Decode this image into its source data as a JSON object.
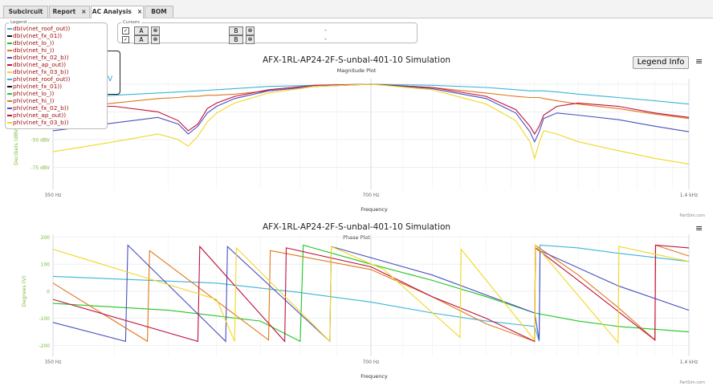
{
  "tabs": [
    {
      "label": "Subcircuit",
      "closable": false
    },
    {
      "label": "Report",
      "closable": true
    },
    {
      "label": "AC Analysis",
      "closable": true,
      "active": true
    },
    {
      "label": "BOM",
      "closable": false
    }
  ],
  "legend": {
    "title": "Legend",
    "items": [
      {
        "label": "db(v(net_roof_out))",
        "color": "#3bb4d8"
      },
      {
        "label": "db(v(net_fx_01))",
        "color": "#111111"
      },
      {
        "label": "db(v(net_lo_))",
        "color": "#22c422"
      },
      {
        "label": "db(v(net_hi_))",
        "color": "#e0771c"
      },
      {
        "label": "db(v(net_fx_02_b))",
        "color": "#4a4fc0"
      },
      {
        "label": "db(v(net_ap_out))",
        "color": "#c0103c"
      },
      {
        "label": "db(v(net_fx_03_b))",
        "color": "#f0d821"
      },
      {
        "label": "ph(v(net_roof_out))",
        "color": "#3bb4d8"
      },
      {
        "label": "ph(v(net_fx_01))",
        "color": "#111111"
      },
      {
        "label": "ph(v(net_lo_))",
        "color": "#22c422"
      },
      {
        "label": "ph(v(net_hi_))",
        "color": "#e0771c"
      },
      {
        "label": "ph(v(net_fx_02_b))",
        "color": "#4a4fc0"
      },
      {
        "label": "ph(v(net_ap_out))",
        "color": "#c0103c"
      },
      {
        "label": "ph(v(net_fx_03_b))",
        "color": "#f0d821"
      }
    ]
  },
  "cursors": {
    "title": "Cursors",
    "rows": [
      {
        "checked": true,
        "a_label": "A",
        "b_label": "B",
        "value": "-"
      },
      {
        "checked": true,
        "a_label": "A",
        "b_label": "B",
        "value": "-"
      }
    ],
    "close_glyph": "⊗"
  },
  "popup": {
    "partial_text": "V"
  },
  "legend_info_label": "Legend Info",
  "menu_glyph": "≡",
  "credit": "PartSim.com",
  "charts": {
    "magnitude": {
      "title": "AFX-1RL-AP24-2F-S-unbal-401-10 Simulation",
      "subtitle": "Magnitude Plot",
      "ylabel": "Decibels (dBV)",
      "xlabel": "Frequency",
      "yticks": [
        "-50 dBV",
        "-75 dBV"
      ],
      "xticks": [
        "350 Hz",
        "700 Hz",
        "1.4 kHz"
      ]
    },
    "phase": {
      "title": "AFX-1RL-AP24-2F-S-unbal-401-10 Simulation",
      "subtitle": "Phase Plot",
      "ylabel": "Degrees (V)",
      "xlabel": "Frequency",
      "yticks": [
        "200",
        "100",
        "0",
        "-100",
        "-200"
      ],
      "xticks": [
        "350 Hz",
        "700 Hz",
        "1.4 kHz"
      ]
    }
  },
  "chart_data": [
    {
      "type": "line",
      "title": "AFX-1RL-AP24-2F-S-unbal-401-10 Simulation",
      "subtitle": "Magnitude Plot",
      "xlabel": "Frequency",
      "ylabel": "Decibels (dBV)",
      "x_scale": "log",
      "xlim": [
        350,
        1400
      ],
      "ylim": [
        -95,
        5
      ],
      "x": [
        350,
        400,
        440,
        460,
        470,
        480,
        490,
        500,
        520,
        560,
        620,
        700,
        800,
        900,
        960,
        990,
        1000,
        1010,
        1020,
        1050,
        1100,
        1200,
        1300,
        1400
      ],
      "series": [
        {
          "name": "db(v(net_roof_out))",
          "color": "#3bb4d8",
          "values": [
            -14,
            -10,
            -8,
            -7,
            -6.5,
            -6,
            -5.5,
            -5,
            -4,
            -2,
            -1,
            0,
            -1,
            -3,
            -5,
            -6,
            -6,
            -6,
            -6,
            -7,
            -9,
            -12,
            -15,
            -18
          ]
        },
        {
          "name": "db(v(net_hi_))",
          "color": "#e0771c",
          "values": [
            -23,
            -17,
            -13,
            -12,
            -11,
            -11,
            -10,
            -10,
            -9,
            -6,
            -2,
            0,
            -3,
            -8,
            -11,
            -12,
            -12,
            -12,
            -13,
            -15,
            -18,
            -22,
            -27,
            -31
          ]
        },
        {
          "name": "db(v(net_ap_out))",
          "color": "#c0103c",
          "values": [
            -20,
            -20,
            -25,
            -33,
            -42,
            -36,
            -22,
            -17,
            -11,
            -5,
            -1,
            0,
            -3,
            -11,
            -23,
            -38,
            -45,
            -38,
            -28,
            -20,
            -17,
            -20,
            -26,
            -30
          ]
        },
        {
          "name": "db(v(net_fx_02_b))",
          "color": "#4a4fc0",
          "values": [
            -42,
            -35,
            -30,
            -36,
            -45,
            -38,
            -26,
            -20,
            -13,
            -6,
            -2,
            0,
            -4,
            -13,
            -26,
            -43,
            -52,
            -43,
            -31,
            -26,
            -28,
            -32,
            -38,
            -43
          ]
        },
        {
          "name": "db(v(net_fx_03_b))",
          "color": "#f0d821",
          "values": [
            -61,
            -52,
            -45,
            -50,
            -56,
            -47,
            -34,
            -26,
            -17,
            -8,
            -2,
            0,
            -5,
            -18,
            -33,
            -52,
            -67,
            -53,
            -42,
            -45,
            -52,
            -60,
            -67,
            -72
          ]
        }
      ]
    },
    {
      "type": "line",
      "title": "AFX-1RL-AP24-2F-S-unbal-401-10 Simulation",
      "subtitle": "Phase Plot",
      "xlabel": "Frequency",
      "ylabel": "Degrees (V)",
      "x_scale": "log",
      "xlim": [
        350,
        1400
      ],
      "ylim": [
        -240,
        210
      ],
      "series": [
        {
          "name": "ph(v(net_roof_out))",
          "color": "#3bb4d8",
          "points": [
            [
              350,
              55
            ],
            [
              500,
              30
            ],
            [
              600,
              -5
            ],
            [
              700,
              -40
            ],
            [
              800,
              -80
            ],
            [
              900,
              -110
            ],
            [
              1000,
              -130
            ],
            [
              1010,
              -185
            ],
            [
              1012,
              170
            ],
            [
              1100,
              160
            ],
            [
              1200,
              140
            ],
            [
              1400,
              110
            ]
          ]
        },
        {
          "name": "ph(v(net_lo_))",
          "color": "#22c422",
          "points": [
            [
              350,
              -45
            ],
            [
              450,
              -70
            ],
            [
              550,
              -110
            ],
            [
              600,
              -185
            ],
            [
              604,
              170
            ],
            [
              700,
              100
            ],
            [
              800,
              40
            ],
            [
              900,
              -20
            ],
            [
              1000,
              -80
            ],
            [
              1100,
              -110
            ],
            [
              1200,
              -130
            ],
            [
              1400,
              -150
            ]
          ]
        },
        {
          "name": "ph(v(net_hi_))",
          "color": "#e0771c",
          "points": [
            [
              350,
              30
            ],
            [
              430,
              -185
            ],
            [
              432,
              150
            ],
            [
              560,
              -180
            ],
            [
              562,
              150
            ],
            [
              700,
              80
            ],
            [
              800,
              -20
            ],
            [
              900,
              -120
            ],
            [
              1000,
              -185
            ],
            [
              1002,
              170
            ],
            [
              1100,
              60
            ],
            [
              1200,
              -60
            ],
            [
              1300,
              -180
            ],
            [
              1302,
              170
            ],
            [
              1400,
              130
            ]
          ]
        },
        {
          "name": "ph(v(net_fx_02_b))",
          "color": "#4a4fc0",
          "points": [
            [
              350,
              -115
            ],
            [
              410,
              -185
            ],
            [
              412,
              170
            ],
            [
              510,
              -185
            ],
            [
              512,
              165
            ],
            [
              640,
              -185
            ],
            [
              642,
              165
            ],
            [
              800,
              60
            ],
            [
              1000,
              -80
            ],
            [
              1010,
              -180
            ],
            [
              1012,
              150
            ],
            [
              1200,
              20
            ],
            [
              1400,
              -70
            ]
          ]
        },
        {
          "name": "ph(v(net_ap_out))",
          "color": "#c0103c",
          "points": [
            [
              350,
              -30
            ],
            [
              480,
              -185
            ],
            [
              482,
              165
            ],
            [
              580,
              -185
            ],
            [
              582,
              160
            ],
            [
              700,
              90
            ],
            [
              800,
              -20
            ],
            [
              900,
              -100
            ],
            [
              1000,
              -185
            ],
            [
              1002,
              160
            ],
            [
              1100,
              40
            ],
            [
              1300,
              -180
            ],
            [
              1302,
              170
            ],
            [
              1400,
              160
            ]
          ]
        },
        {
          "name": "ph(v(net_fx_03_b))",
          "color": "#f0d821",
          "points": [
            [
              350,
              155
            ],
            [
              500,
              -30
            ],
            [
              520,
              -185
            ],
            [
              522,
              160
            ],
            [
              640,
              -185
            ],
            [
              642,
              165
            ],
            [
              720,
              80
            ],
            [
              850,
              -170
            ],
            [
              852,
              155
            ],
            [
              1000,
              -180
            ],
            [
              1002,
              170
            ],
            [
              1200,
              -190
            ],
            [
              1202,
              165
            ],
            [
              1400,
              110
            ]
          ]
        }
      ]
    }
  ]
}
